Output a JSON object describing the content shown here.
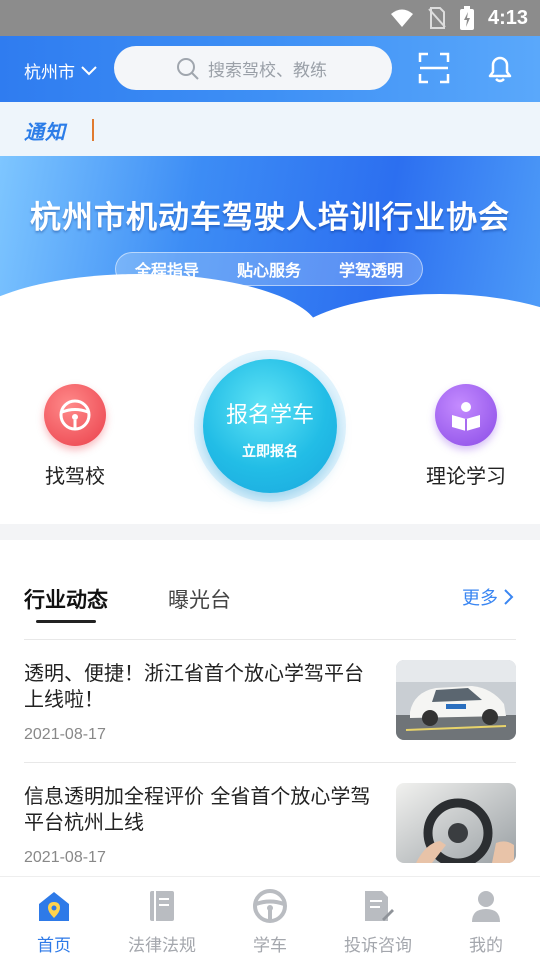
{
  "status_bar": {
    "time": "4:13",
    "icons": [
      "wifi-icon",
      "sim-off-icon",
      "battery-charging-icon"
    ]
  },
  "header": {
    "city": "杭州市",
    "search": {
      "placeholder": "搜索驾校、教练"
    },
    "icons": [
      "scan-icon",
      "bell-icon"
    ],
    "accent_color": "#3e90f5"
  },
  "notice": {
    "label": "通知",
    "text": ""
  },
  "banner": {
    "title": "杭州市机动车驾驶人培训行业协会",
    "tags": [
      "全程指导",
      "贴心服务",
      "学驾透明"
    ]
  },
  "quick_actions": {
    "left": {
      "label": "找驾校",
      "icon": "steering-wheel-icon"
    },
    "center": {
      "label": "报名学车",
      "sub_label": "立即报名"
    },
    "right": {
      "label": "理论学习",
      "icon": "reading-icon"
    }
  },
  "news": {
    "tabs": [
      {
        "label": "行业动态",
        "active": true
      },
      {
        "label": "曝光台",
        "active": false
      }
    ],
    "more_label": "更多",
    "items": [
      {
        "title": "透明、便捷！浙江省首个放心学驾平台上线啦！",
        "date": "2021-08-17",
        "image": "driving-school-car-photo"
      },
      {
        "title": "信息透明加全程评价 全省首个放心学驾平台杭州上线",
        "date": "2021-08-17",
        "image": "steering-wheel-photo"
      }
    ]
  },
  "bottom_nav": {
    "items": [
      {
        "label": "首页",
        "icon": "home-icon",
        "active": true
      },
      {
        "label": "法律法规",
        "icon": "book-icon",
        "active": false
      },
      {
        "label": "学车",
        "icon": "steering-wheel-icon",
        "active": false
      },
      {
        "label": "投诉咨询",
        "icon": "document-edit-icon",
        "active": false
      },
      {
        "label": "我的",
        "icon": "user-icon",
        "active": false
      }
    ],
    "active_color": "#2e7ae8",
    "inactive_color": "#a4a7ad"
  }
}
